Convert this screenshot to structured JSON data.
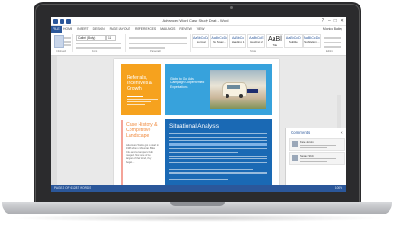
{
  "window": {
    "title": "Advanced Word Case Study Draft - Word",
    "controls": [
      "?",
      "–",
      "□",
      "✕"
    ]
  },
  "ribbon": {
    "file_tab": "FILE",
    "tabs": [
      "HOME",
      "INSERT",
      "DESIGN",
      "PAGE LAYOUT",
      "REFERENCES",
      "MAILINGS",
      "REVIEW",
      "VIEW"
    ],
    "user": "Monica Bailey",
    "font_name": "Calibri (Body)",
    "font_size": "11",
    "styles": [
      {
        "sample": "AaBbCcDc",
        "name": "Normal"
      },
      {
        "sample": "AaBbCcDc",
        "name": "No Spac..."
      },
      {
        "sample": "AaBbCc",
        "name": "Heading 1"
      },
      {
        "sample": "AaBbCcE",
        "name": "Heading 2"
      },
      {
        "sample": "AaBl",
        "name": "Title"
      },
      {
        "sample": "AaBbCcD",
        "name": "Subtitle"
      },
      {
        "sample": "AaBbCcDc",
        "name": "Subtle Em..."
      }
    ],
    "group_labels": [
      "Clipboard",
      "Font",
      "Paragraph",
      "Styles",
      "Editing"
    ]
  },
  "document": {
    "orange_card_title": "Referrals, Incentives & Growth",
    "blue_card_text": "Globe to Go: Ads Campaign Outperformed Expectations",
    "left_heading": "Case History & Competitive Landscape",
    "left_body": "Adventure Works got its start in 1998 when a Mountain Bike Club and a Campers Club merged. Now one of the largest of their kind, they began...",
    "section_heading": "Situational Analysis"
  },
  "comments_pane": {
    "title": "Comments",
    "items": [
      {
        "author": "Katie Jordan"
      },
      {
        "author": "Sanjay Shah"
      }
    ]
  },
  "status": {
    "left": "PAGE 2 OF 6   1287 WORDS",
    "right": "100%"
  }
}
